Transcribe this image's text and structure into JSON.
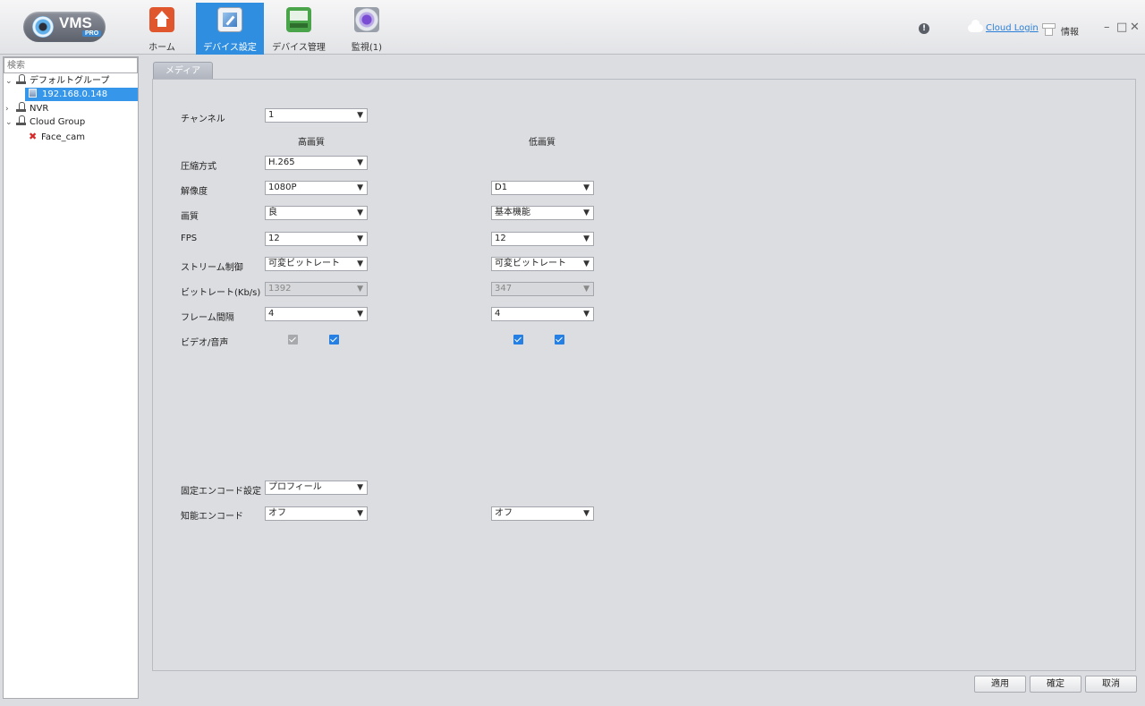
{
  "logo": {
    "text": "VMS",
    "badge": "PRO"
  },
  "nav": {
    "home": "ホーム",
    "device_settings": "デバイス設定",
    "device_management": "デバイス管理",
    "monitor": "監視(1)"
  },
  "topright": {
    "alert": "!",
    "cloud_login": "Cloud Login",
    "info": "情報",
    "min": "–",
    "max": "□",
    "close": "✕"
  },
  "sidebar": {
    "search_placeholder": "検索",
    "tree": {
      "default_group": "デフォルトグループ",
      "device_ip": "192.168.0.148",
      "nvr": "NVR",
      "cloud_group": "Cloud Group",
      "face_cam": "Face_cam"
    }
  },
  "tabs": {
    "media": "メディア"
  },
  "form": {
    "channel_label": "チャンネル",
    "channel_value": "1",
    "high_quality": "高画質",
    "low_quality": "低画質",
    "compression_label": "圧縮方式",
    "compression_high": "H.265",
    "resolution_label": "解像度",
    "resolution_high": "1080P",
    "resolution_low": "D1",
    "quality_label": "画質",
    "quality_high": "良",
    "quality_low": "基本機能",
    "fps_label": "FPS",
    "fps_high": "12",
    "fps_low": "12",
    "stream_label": "ストリーム制御",
    "stream_high": "可変ビットレート",
    "stream_low": "可変ビットレート",
    "bitrate_label": "ビットレート(Kb/s)",
    "bitrate_high": "1392",
    "bitrate_low": "347",
    "frame_label": "フレーム間隔",
    "frame_high": "4",
    "frame_low": "4",
    "av_label": "ビデオ/音声",
    "fixed_encode_label": "固定エンコード設定",
    "fixed_encode_value": "プロフィール",
    "smart_encode_label": "知能エンコード",
    "smart_encode_high": "オフ",
    "smart_encode_low": "オフ",
    "dropdown_glyph": "▼"
  },
  "buttons": {
    "apply": "適用",
    "ok": "確定",
    "cancel": "取消"
  },
  "colors": {
    "accent": "#2f8ee0",
    "checkbox": "#2680e4",
    "link": "#2c7fd6"
  }
}
